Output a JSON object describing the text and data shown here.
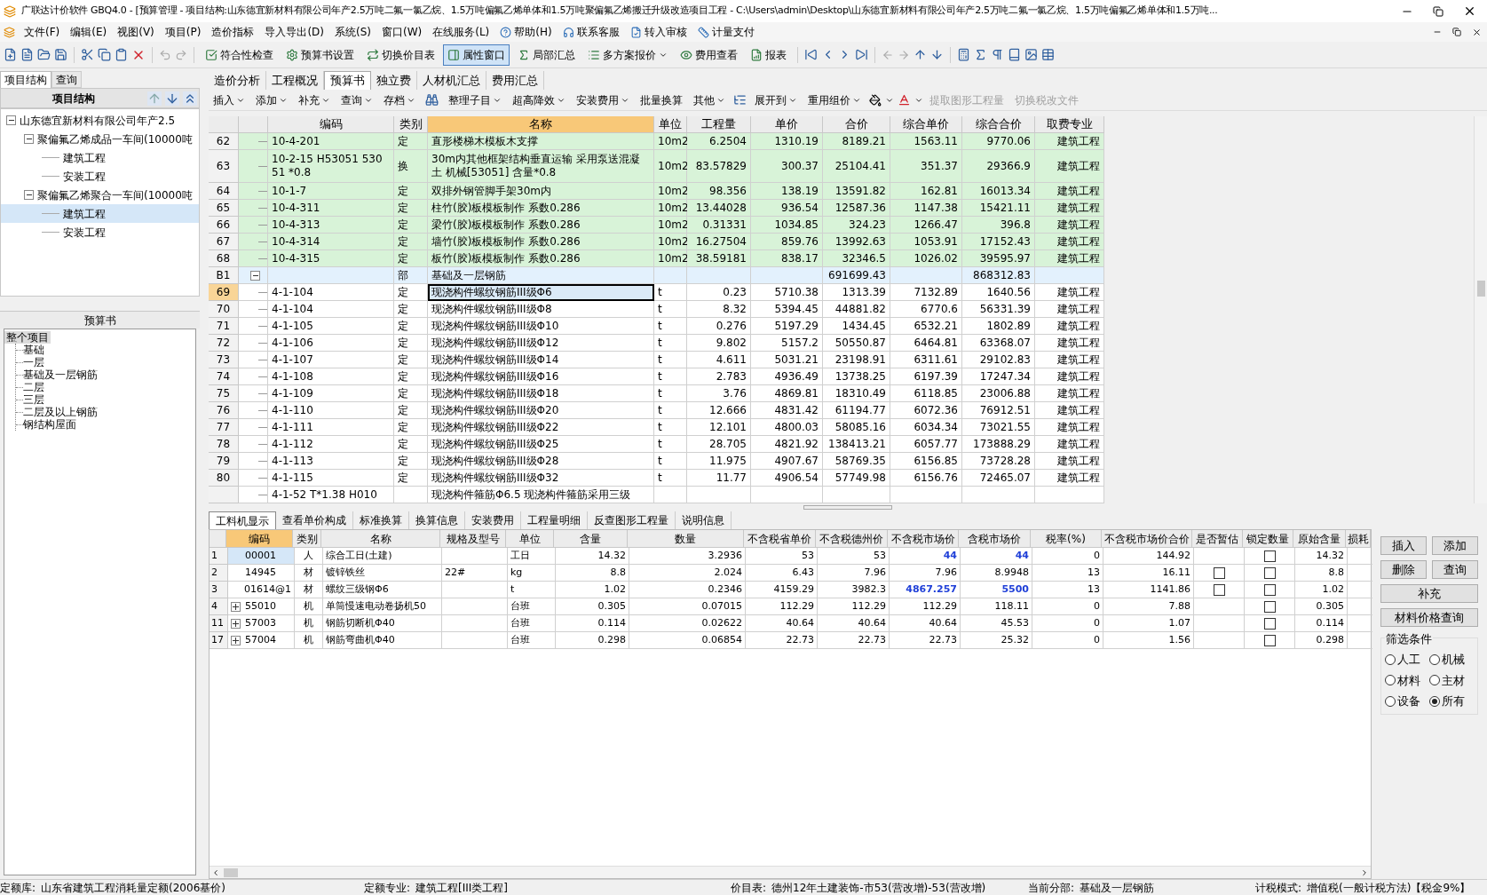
{
  "window": {
    "title": "广联达计价软件 GBQ4.0 - [预算管理 - 项目结构:山东德宜新材料有限公司年产2.5万吨二氟一氯乙烷、1.5万吨偏氟乙烯单体和1.5万吨聚偏氟乙烯搬迁升级改造项目工程 - C:\\Users\\admin\\Desktop\\山东德宜新材料有限公司年产2.5万吨二氟一氯乙烷、1.5万吨偏氟乙烯单体和1.5万吨..."
  },
  "menu": [
    "文件(F)",
    "编辑(E)",
    "视图(V)",
    "项目(P)",
    "造价指标",
    "导入导出(D)",
    "系统(S)",
    "窗口(W)",
    "在线服务(L)"
  ],
  "menu_links": [
    "帮助(H)",
    "联系客服",
    "转入审核",
    "计量支付"
  ],
  "toolbar": [
    {
      "label": "符合性检查",
      "pressed": false,
      "dropdown": false
    },
    {
      "label": "预算书设置",
      "pressed": false,
      "dropdown": false
    },
    {
      "label": "切换价目表",
      "pressed": false,
      "dropdown": false
    },
    {
      "label": "属性窗口",
      "pressed": true,
      "dropdown": false
    },
    {
      "label": "局部汇总",
      "pressed": false,
      "dropdown": false
    },
    {
      "label": "多方案报价",
      "pressed": false,
      "dropdown": true
    },
    {
      "label": "费用查看",
      "pressed": false,
      "dropdown": false
    },
    {
      "label": "报表",
      "pressed": false,
      "dropdown": false
    }
  ],
  "left_tabs": [
    {
      "label": "项目结构",
      "selected": true
    },
    {
      "label": "查询",
      "selected": false
    }
  ],
  "structure": {
    "title": "项目结构",
    "tree": [
      {
        "label": "山东德宜新材料有限公司年产2.5",
        "expanded": true,
        "selected": false,
        "children": [
          {
            "label": "聚偏氟乙烯成品一车间(10000吨",
            "expanded": true,
            "selected": false,
            "children": [
              {
                "label": "建筑工程",
                "selected": false
              },
              {
                "label": "安装工程",
                "selected": false
              }
            ]
          },
          {
            "label": "聚偏氟乙烯聚合一车间(10000吨",
            "expanded": true,
            "selected": false,
            "children": [
              {
                "label": "建筑工程",
                "selected": true
              },
              {
                "label": "安装工程",
                "selected": false
              }
            ]
          }
        ]
      }
    ]
  },
  "budget_panel": {
    "title": "预算书",
    "tree": [
      {
        "label": "整个项目",
        "selected": true,
        "children": [
          {
            "label": "基础",
            "selected": false
          },
          {
            "label": "一层",
            "selected": false
          },
          {
            "label": "基础及一层钢筋",
            "selected": false
          },
          {
            "label": "二层",
            "selected": false
          },
          {
            "label": "三层",
            "selected": false
          },
          {
            "label": "二层及以上钢筋",
            "selected": false
          },
          {
            "label": "钢结构屋面",
            "selected": false
          }
        ]
      }
    ]
  },
  "main_tabs": [
    {
      "label": "造价分析",
      "selected": false
    },
    {
      "label": "工程概况",
      "selected": false
    },
    {
      "label": "预算书",
      "selected": true
    },
    {
      "label": "独立费",
      "selected": false
    },
    {
      "label": "人材机汇总",
      "selected": false
    },
    {
      "label": "费用汇总",
      "selected": false
    }
  ],
  "sub_toolbar": [
    {
      "label": "插入",
      "dropdown": true,
      "disabled": false
    },
    {
      "label": "添加",
      "dropdown": true,
      "disabled": false
    },
    {
      "label": "补充",
      "dropdown": true,
      "disabled": false
    },
    {
      "label": "查询",
      "dropdown": true,
      "disabled": false
    },
    {
      "label": "存档",
      "dropdown": true,
      "disabled": false
    },
    {
      "label": "整理子目",
      "dropdown": true,
      "disabled": false
    },
    {
      "label": "超高降效",
      "dropdown": true,
      "disabled": false
    },
    {
      "label": "安装费用",
      "dropdown": true,
      "disabled": false
    },
    {
      "label": "批量换算",
      "dropdown": false,
      "disabled": false
    },
    {
      "label": "其他",
      "dropdown": true,
      "disabled": false
    },
    {
      "label": "展开到",
      "dropdown": true,
      "disabled": false
    },
    {
      "label": "重用组价",
      "dropdown": true,
      "disabled": false
    },
    {
      "label": "提取图形工程量",
      "dropdown": false,
      "disabled": true
    },
    {
      "label": "切换税改文件",
      "dropdown": false,
      "disabled": true
    }
  ],
  "table": {
    "columns": [
      {
        "label": "编码",
        "highlighted": false
      },
      {
        "label": "类别",
        "highlighted": false
      },
      {
        "label": "名称",
        "highlighted": true
      },
      {
        "label": "单位",
        "highlighted": false
      },
      {
        "label": "工程量",
        "highlighted": false
      },
      {
        "label": "单价",
        "highlighted": false
      },
      {
        "label": "合价",
        "highlighted": false
      },
      {
        "label": "综合单价",
        "highlighted": false
      },
      {
        "label": "综合合价",
        "highlighted": false
      },
      {
        "label": "取费专业",
        "highlighted": false
      }
    ],
    "rows": [
      {
        "kind": "item",
        "no": "62",
        "code": "10-4-201",
        "type": "定",
        "name": "直形楼梯木模板木支撑",
        "unit": "10m2",
        "qty": "6.2504",
        "price": "1310.19",
        "total": "8189.21",
        "unit_price": "1563.11",
        "sum": "9770.06",
        "specialty": "建筑工程",
        "shaded": true,
        "selected": false
      },
      {
        "kind": "item",
        "no": "63",
        "code": "10-2-15 H53051 530 51 *0.8",
        "type": "换",
        "name": "30m内其他框架结构垂直运输 采用泵送混凝土 机械[53051] 含量*0.8",
        "unit": "10m2",
        "qty": "83.57829",
        "price": "300.37",
        "total": "25104.41",
        "unit_price": "351.37",
        "sum": "29366.9",
        "specialty": "建筑工程",
        "shaded": true,
        "selected": false
      },
      {
        "kind": "item",
        "no": "64",
        "code": "10-1-7",
        "type": "定",
        "name": "双排外钢管脚手架30m内",
        "unit": "10m2",
        "qty": "98.356",
        "price": "138.19",
        "total": "13591.82",
        "unit_price": "162.81",
        "sum": "16013.34",
        "specialty": "建筑工程",
        "shaded": true,
        "selected": false
      },
      {
        "kind": "item",
        "no": "65",
        "code": "10-4-311",
        "type": "定",
        "name": "柱竹(胶)板模板制作 系数0.286",
        "unit": "10m2",
        "qty": "13.44028",
        "price": "936.54",
        "total": "12587.36",
        "unit_price": "1147.38",
        "sum": "15421.11",
        "specialty": "建筑工程",
        "shaded": true,
        "selected": false
      },
      {
        "kind": "item",
        "no": "66",
        "code": "10-4-313",
        "type": "定",
        "name": "梁竹(胶)板模板制作 系数0.286",
        "unit": "10m2",
        "qty": "0.31331",
        "price": "1034.85",
        "total": "324.23",
        "unit_price": "1266.47",
        "sum": "396.8",
        "specialty": "建筑工程",
        "shaded": true,
        "selected": false
      },
      {
        "kind": "item",
        "no": "67",
        "code": "10-4-314",
        "type": "定",
        "name": "墙竹(胶)板模板制作 系数0.286",
        "unit": "10m2",
        "qty": "16.27504",
        "price": "859.76",
        "total": "13992.63",
        "unit_price": "1053.91",
        "sum": "17152.43",
        "specialty": "建筑工程",
        "shaded": true,
        "selected": false
      },
      {
        "kind": "item",
        "no": "68",
        "code": "10-4-315",
        "type": "定",
        "name": "板竹(胶)板模板制作 系数0.286",
        "unit": "10m2",
        "qty": "38.59181",
        "price": "838.17",
        "total": "32346.5",
        "unit_price": "1026.02",
        "sum": "39595.97",
        "specialty": "建筑工程",
        "shaded": true,
        "selected": false
      },
      {
        "kind": "section",
        "no": "B1",
        "expanded": true,
        "type": "部",
        "name": "基础及一层钢筋",
        "total": "691699.43",
        "sum": "868312.83",
        "selected": false
      },
      {
        "kind": "item",
        "no": "69",
        "code": "4-1-104",
        "type": "定",
        "name": "现浇构件螺纹钢筋III级Φ6",
        "unit": "t",
        "qty": "0.23",
        "price": "5710.38",
        "total": "1313.39",
        "unit_price": "7132.89",
        "sum": "1640.56",
        "specialty": "建筑工程",
        "shaded": false,
        "selected": true
      },
      {
        "kind": "item",
        "no": "70",
        "code": "4-1-104",
        "type": "定",
        "name": "现浇构件螺纹钢筋III级Φ8",
        "unit": "t",
        "qty": "8.32",
        "price": "5394.45",
        "total": "44881.82",
        "unit_price": "6770.6",
        "sum": "56331.39",
        "specialty": "建筑工程",
        "shaded": false,
        "selected": false
      },
      {
        "kind": "item",
        "no": "71",
        "code": "4-1-105",
        "type": "定",
        "name": "现浇构件螺纹钢筋III级Φ10",
        "unit": "t",
        "qty": "0.276",
        "price": "5197.29",
        "total": "1434.45",
        "unit_price": "6532.21",
        "sum": "1802.89",
        "specialty": "建筑工程",
        "shaded": false,
        "selected": false
      },
      {
        "kind": "item",
        "no": "72",
        "code": "4-1-106",
        "type": "定",
        "name": "现浇构件螺纹钢筋III级Φ12",
        "unit": "t",
        "qty": "9.802",
        "price": "5157.2",
        "total": "50550.87",
        "unit_price": "6464.81",
        "sum": "63368.07",
        "specialty": "建筑工程",
        "shaded": false,
        "selected": false
      },
      {
        "kind": "item",
        "no": "73",
        "code": "4-1-107",
        "type": "定",
        "name": "现浇构件螺纹钢筋III级Φ14",
        "unit": "t",
        "qty": "4.611",
        "price": "5031.21",
        "total": "23198.91",
        "unit_price": "6311.61",
        "sum": "29102.83",
        "specialty": "建筑工程",
        "shaded": false,
        "selected": false
      },
      {
        "kind": "item",
        "no": "74",
        "code": "4-1-108",
        "type": "定",
        "name": "现浇构件螺纹钢筋III级Φ16",
        "unit": "t",
        "qty": "2.783",
        "price": "4936.49",
        "total": "13738.25",
        "unit_price": "6197.39",
        "sum": "17247.34",
        "specialty": "建筑工程",
        "shaded": false,
        "selected": false
      },
      {
        "kind": "item",
        "no": "75",
        "code": "4-1-109",
        "type": "定",
        "name": "现浇构件螺纹钢筋III级Φ18",
        "unit": "t",
        "qty": "3.76",
        "price": "4869.81",
        "total": "18310.49",
        "unit_price": "6118.85",
        "sum": "23006.88",
        "specialty": "建筑工程",
        "shaded": false,
        "selected": false
      },
      {
        "kind": "item",
        "no": "76",
        "code": "4-1-110",
        "type": "定",
        "name": "现浇构件螺纹钢筋III级Φ20",
        "unit": "t",
        "qty": "12.666",
        "price": "4831.42",
        "total": "61194.77",
        "unit_price": "6072.36",
        "sum": "76912.51",
        "specialty": "建筑工程",
        "shaded": false,
        "selected": false
      },
      {
        "kind": "item",
        "no": "77",
        "code": "4-1-111",
        "type": "定",
        "name": "现浇构件螺纹钢筋III级Φ22",
        "unit": "t",
        "qty": "12.101",
        "price": "4800.03",
        "total": "58085.16",
        "unit_price": "6034.34",
        "sum": "73021.55",
        "specialty": "建筑工程",
        "shaded": false,
        "selected": false
      },
      {
        "kind": "item",
        "no": "78",
        "code": "4-1-112",
        "type": "定",
        "name": "现浇构件螺纹钢筋III级Φ25",
        "unit": "t",
        "qty": "28.705",
        "price": "4821.92",
        "total": "138413.21",
        "unit_price": "6057.77",
        "sum": "173888.29",
        "specialty": "建筑工程",
        "shaded": false,
        "selected": false
      },
      {
        "kind": "item",
        "no": "79",
        "code": "4-1-113",
        "type": "定",
        "name": "现浇构件螺纹钢筋III级Φ28",
        "unit": "t",
        "qty": "11.975",
        "price": "4907.67",
        "total": "58769.35",
        "unit_price": "6156.85",
        "sum": "73728.28",
        "specialty": "建筑工程",
        "shaded": false,
        "selected": false
      },
      {
        "kind": "item",
        "no": "80",
        "code": "4-1-115",
        "type": "定",
        "name": "现浇构件螺纹钢筋III级Φ32",
        "unit": "t",
        "qty": "11.77",
        "price": "4906.54",
        "total": "57749.98",
        "unit_price": "6156.76",
        "sum": "72465.07",
        "specialty": "建筑工程",
        "shaded": false,
        "selected": false
      },
      {
        "kind": "item",
        "code": "4-1-52 T*1.38 H010",
        "name": "现浇构件箍筋Φ6.5 现浇构件箍筋采用三级",
        "shaded": false,
        "selected": false
      }
    ]
  },
  "detail_tabs": [
    {
      "label": "工料机显示",
      "selected": true
    },
    {
      "label": "查看单价构成",
      "selected": false
    },
    {
      "label": "标准换算",
      "selected": false
    },
    {
      "label": "换算信息",
      "selected": false
    },
    {
      "label": "安装费用",
      "selected": false
    },
    {
      "label": "工程量明细",
      "selected": false
    },
    {
      "label": "反查图形工程量",
      "selected": false
    },
    {
      "label": "说明信息",
      "selected": false
    }
  ],
  "detail_table": {
    "columns": [
      "编码",
      "类别",
      "名称",
      "规格及型号",
      "单位",
      "含量",
      "数量",
      "不含税省单价",
      "不含税德州价",
      "不含税市场价",
      "含税市场价",
      "税率(%)",
      "不含税市场价合价",
      "是否暂估",
      "锁定数量",
      "原始含量",
      "损耗"
    ],
    "rows": [
      {
        "no": "1",
        "expandable": false,
        "selected": true,
        "modified": true,
        "code": "00001",
        "type": "人",
        "name": "综合工日(土建)",
        "unit": "工日",
        "content": "14.32",
        "quantity": "3.2936",
        "prov_price": "53",
        "dz_price": "53",
        "market_price": "44",
        "market_price_tax": "44",
        "tax_rate": "0",
        "market_total": "144.92",
        "locked": false,
        "original": "14.32"
      },
      {
        "no": "2",
        "expandable": false,
        "selected": false,
        "modified": false,
        "code": "14945",
        "type": "材",
        "name": "镀锌铁丝",
        "spec": "22#",
        "unit": "kg",
        "content": "8.8",
        "quantity": "2.024",
        "prov_price": "6.43",
        "dz_price": "7.96",
        "market_price": "7.96",
        "market_price_tax": "8.9948",
        "tax_rate": "13",
        "market_total": "16.11",
        "provisional": false,
        "locked": false,
        "original": "8.8"
      },
      {
        "no": "3",
        "expandable": false,
        "selected": false,
        "modified": true,
        "code": "01614@1",
        "type": "材",
        "name": "螺纹三级钢Φ6",
        "unit": "t",
        "content": "1.02",
        "quantity": "0.2346",
        "prov_price": "4159.29",
        "dz_price": "3982.3",
        "market_price": "4867.257",
        "market_price_tax": "5500",
        "tax_rate": "13",
        "market_total": "1141.86",
        "provisional": false,
        "locked": false,
        "original": "1.02"
      },
      {
        "no": "4",
        "expandable": true,
        "selected": false,
        "modified": false,
        "code": "55010",
        "type": "机",
        "name": "单筒慢速电动卷扬机50",
        "unit": "台班",
        "content": "0.305",
        "quantity": "0.07015",
        "prov_price": "112.29",
        "dz_price": "112.29",
        "market_price": "112.29",
        "market_price_tax": "118.11",
        "tax_rate": "0",
        "market_total": "7.88",
        "locked": false,
        "original": "0.305"
      },
      {
        "no": "11",
        "expandable": true,
        "selected": false,
        "modified": false,
        "code": "57003",
        "type": "机",
        "name": "钢筋切断机Φ40",
        "unit": "台班",
        "content": "0.114",
        "quantity": "0.02622",
        "prov_price": "40.64",
        "dz_price": "40.64",
        "market_price": "40.64",
        "market_price_tax": "45.53",
        "tax_rate": "0",
        "market_total": "1.07",
        "locked": false,
        "original": "0.114"
      },
      {
        "no": "17",
        "expandable": true,
        "selected": false,
        "modified": false,
        "code": "57004",
        "type": "机",
        "name": "钢筋弯曲机Φ40",
        "unit": "台班",
        "content": "0.298",
        "quantity": "0.06854",
        "prov_price": "22.73",
        "dz_price": "22.73",
        "market_price": "22.73",
        "market_price_tax": "25.32",
        "tax_rate": "0",
        "market_total": "1.56",
        "locked": false,
        "original": "0.298"
      }
    ]
  },
  "side_buttons": [
    "插入",
    "添加",
    "删除",
    "查询",
    "补充",
    "材料价格查询"
  ],
  "filter": {
    "title": "筛选条件",
    "options": [
      {
        "label": "人工",
        "selected": false
      },
      {
        "label": "机械",
        "selected": false
      },
      {
        "label": "材料",
        "selected": false
      },
      {
        "label": "主材",
        "selected": false
      },
      {
        "label": "设备",
        "selected": false
      },
      {
        "label": "所有",
        "selected": true
      }
    ]
  },
  "status_bar": [
    {
      "label": "定额库:",
      "value": "山东省建筑工程消耗量定额(2006基价)"
    },
    {
      "label": "定额专业:",
      "value": "建筑工程[III类工程]"
    },
    {
      "label": "价目表:",
      "value": "德州12年土建装饰-市53(营改增)-53(营改增)"
    },
    {
      "label": "当前分部:",
      "value": "基础及一层钢筋"
    },
    {
      "label": "计税模式:",
      "value": "增值税(一般计税方法)【税金9%】"
    }
  ]
}
